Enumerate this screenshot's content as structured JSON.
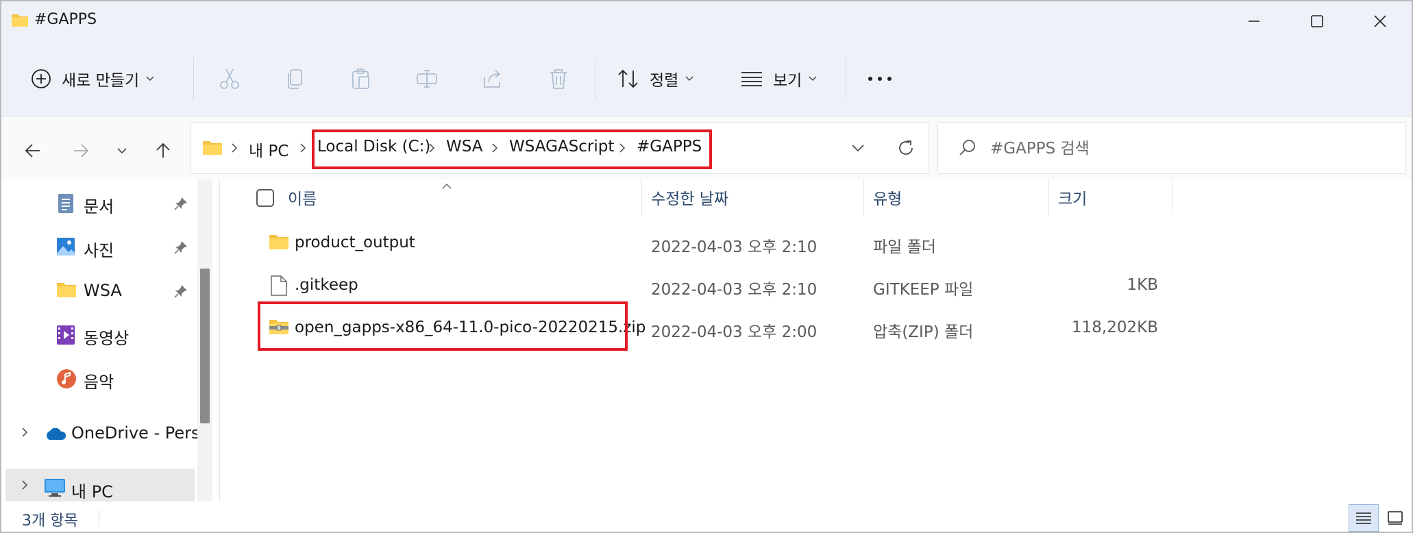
{
  "window": {
    "title": "#GAPPS"
  },
  "toolbar": {
    "new_label": "새로 만들기",
    "sort_label": "정렬",
    "view_label": "보기"
  },
  "address": {
    "crumbs": [
      "내 PC",
      "Local Disk (C:)",
      "WSA",
      "WSAGAScript",
      "#GAPPS"
    ]
  },
  "search": {
    "placeholder": "#GAPPS 검색"
  },
  "sidebar": {
    "items": [
      {
        "label": "문서",
        "icon": "document-icon",
        "pinned": true
      },
      {
        "label": "사진",
        "icon": "pictures-icon",
        "pinned": true
      },
      {
        "label": "WSA",
        "icon": "folder-icon",
        "pinned": true
      },
      {
        "label": "동영상",
        "icon": "video-icon",
        "pinned": false
      },
      {
        "label": "음악",
        "icon": "music-icon",
        "pinned": false
      },
      {
        "label": "OneDrive - Perso",
        "icon": "onedrive-icon",
        "expandable": true
      },
      {
        "label": "내 PC",
        "icon": "pc-icon",
        "expandable": true,
        "selected": true
      }
    ]
  },
  "columns": {
    "name": "이름",
    "date": "수정한 날짜",
    "type": "유형",
    "size": "크기"
  },
  "files": [
    {
      "name": "product_output",
      "date": "2022-04-03 오후 2:10",
      "type": "파일 폴더",
      "size": "",
      "icon": "folder-icon"
    },
    {
      "name": ".gitkeep",
      "date": "2022-04-03 오후 2:10",
      "type": "GITKEEP 파일",
      "size": "1KB",
      "icon": "file-icon"
    },
    {
      "name": "open_gapps-x86_64-11.0-pico-20220215.zip",
      "date": "2022-04-03 오후 2:00",
      "type": "압축(ZIP) 폴더",
      "size": "118,202KB",
      "icon": "zip-folder-icon"
    }
  ],
  "status": {
    "count": "3개 항목"
  },
  "colors": {
    "highlight": "#e21b25",
    "accent": "#0067c0",
    "folder": "#f5c342"
  }
}
